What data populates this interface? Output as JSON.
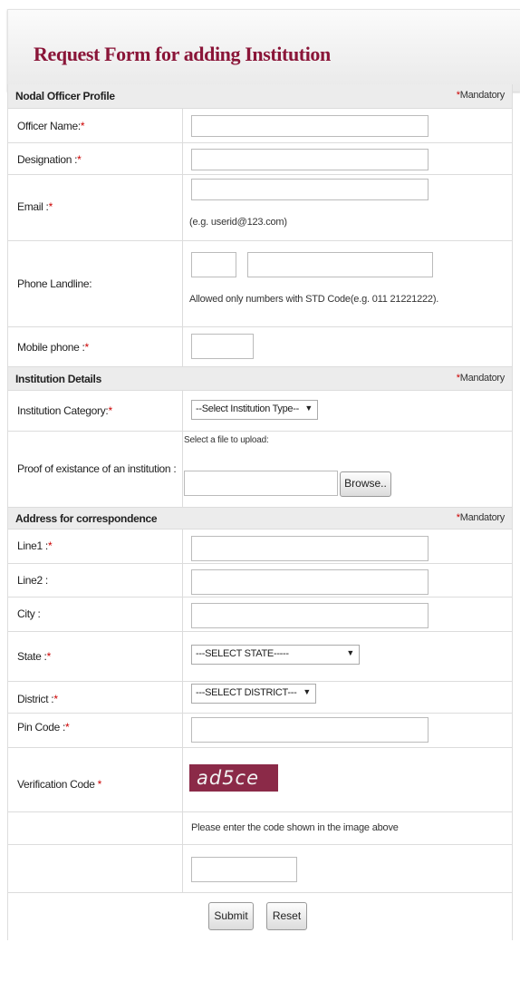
{
  "page": {
    "title": "Request Form for adding Institution"
  },
  "mandatory": {
    "star": "*",
    "text": "Mandatory"
  },
  "sections": {
    "nodal": "Nodal Officer Profile",
    "institution": "Institution Details",
    "address": "Address for correspondence"
  },
  "fields": {
    "officer_name": "Officer Name:",
    "designation": "Designation :",
    "email": "Email :",
    "email_hint": "(e.g. userid@123.com)",
    "phone_landline": "Phone Landline:",
    "phone_hint": "Allowed only numbers with STD Code(e.g. 011 21221222).",
    "mobile": "Mobile phone :",
    "institution_category": "Institution Category:",
    "institution_select": "--Select Institution Type--",
    "proof": "Proof of existance of an institution :",
    "file_prompt": "Select a file to upload:",
    "browse": "Browse..",
    "line1": "Line1 :",
    "line2": "Line2 :",
    "city": "City :",
    "state": "State :",
    "state_select": "---SELECT STATE-----",
    "district": "District :",
    "district_select": "---SELECT DISTRICT---",
    "pin": "Pin Code :",
    "verification": "Verification Code",
    "captcha": "ad5ce",
    "captcha_hint": "Please enter the code shown in the image above"
  },
  "buttons": {
    "submit": "Submit",
    "reset": "Reset"
  },
  "icons": {
    "dropdown": "dropdown-arrow-icon"
  },
  "colors": {
    "title": "#8a1538",
    "required": "#cc0000",
    "captcha_bg": "#8b2a48"
  }
}
